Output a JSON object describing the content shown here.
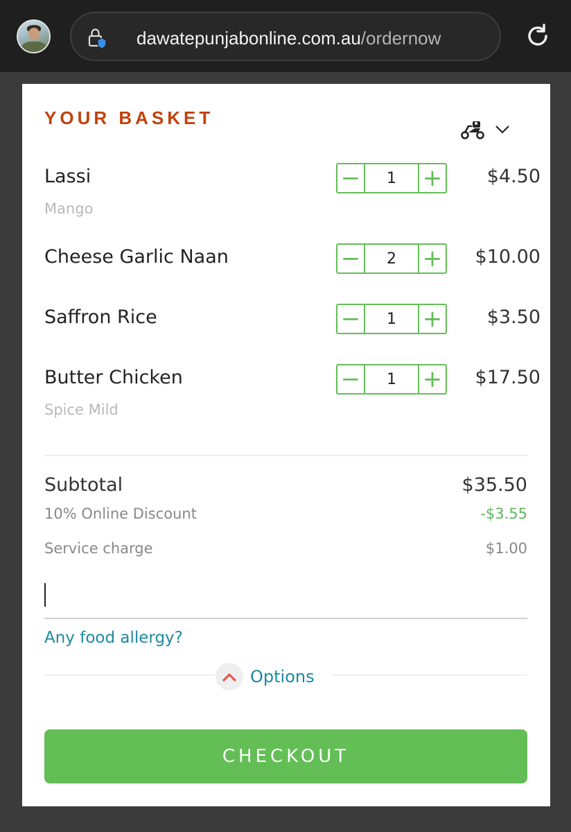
{
  "browser": {
    "url_domain": "dawatepunjabonline.com.au",
    "url_path": "/ordernow",
    "icons": [
      "avatar",
      "lock-shield-icon",
      "reload-icon"
    ]
  },
  "basket": {
    "title": "YOUR BASKET",
    "delivery_icon": "scooter-icon",
    "items": [
      {
        "name": "Lassi",
        "option": "Mango",
        "quantity": "1",
        "price": "$4.50"
      },
      {
        "name": "Cheese Garlic Naan",
        "option": "",
        "quantity": "2",
        "price": "$10.00"
      },
      {
        "name": "Saffron Rice",
        "option": "",
        "quantity": "1",
        "price": "$3.50"
      },
      {
        "name": "Butter Chicken",
        "option": "Spice Mild",
        "quantity": "1",
        "price": "$17.50"
      }
    ],
    "stepper_minus": "−",
    "stepper_plus": "+"
  },
  "summary": {
    "subtotal_label": "Subtotal",
    "subtotal_value": "$35.50",
    "discount_label": "10% Online Discount",
    "discount_value": "-$3.55",
    "service_label": "Service charge",
    "service_value": "$1.00"
  },
  "note": {
    "value": ""
  },
  "allergy_link": "Any food allergy?",
  "options_label": "Options",
  "checkout_label": "CHECKOUT",
  "colors": {
    "accent_green": "#63be56",
    "title_orange": "#c2410c",
    "link_teal": "#1b8aa0",
    "discount_green": "#5cb85c"
  }
}
